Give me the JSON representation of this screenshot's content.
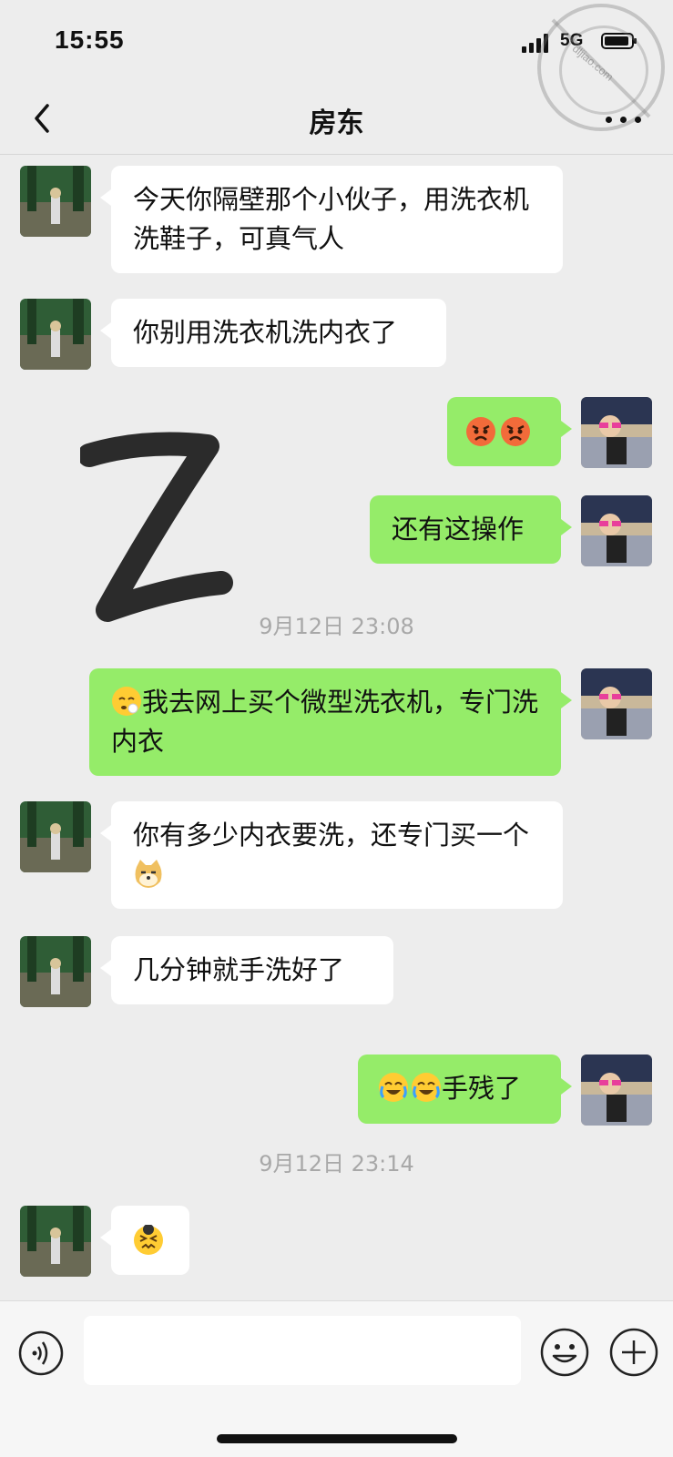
{
  "status": {
    "time": "15:55",
    "network": "5G",
    "watermark": "dljiao.com"
  },
  "header": {
    "title": "房东"
  },
  "messages": [
    {
      "side": "in",
      "text": "今天你隔壁那个小伙子，用洗衣机洗鞋子，可真气人"
    },
    {
      "side": "in",
      "text": "你别用洗衣机洗内衣了"
    },
    {
      "side": "out",
      "icons": [
        "angry-face-icon",
        "angry-face-icon"
      ]
    },
    {
      "side": "out",
      "text": "还有这操作"
    },
    {
      "timestamp": "9月12日 23:08"
    },
    {
      "side": "out",
      "icon": "sigh-face-icon",
      "text": "我去网上买个微型洗衣机，专门洗内衣"
    },
    {
      "side": "in",
      "text": "你有多少内衣要洗，还专门买一个",
      "icon": "doge-icon"
    },
    {
      "side": "in",
      "text": "几分钟就手洗好了"
    },
    {
      "side": "out",
      "icons": [
        "crying-laugh-icon",
        "crying-laugh-icon"
      ],
      "text": "手残了"
    },
    {
      "timestamp": "9月12日 23:14"
    },
    {
      "side": "in",
      "icon": "frustrated-face-icon"
    }
  ],
  "colors": {
    "out_bubble": "#95ec69",
    "in_bubble": "#ffffff",
    "background": "#ededed"
  }
}
